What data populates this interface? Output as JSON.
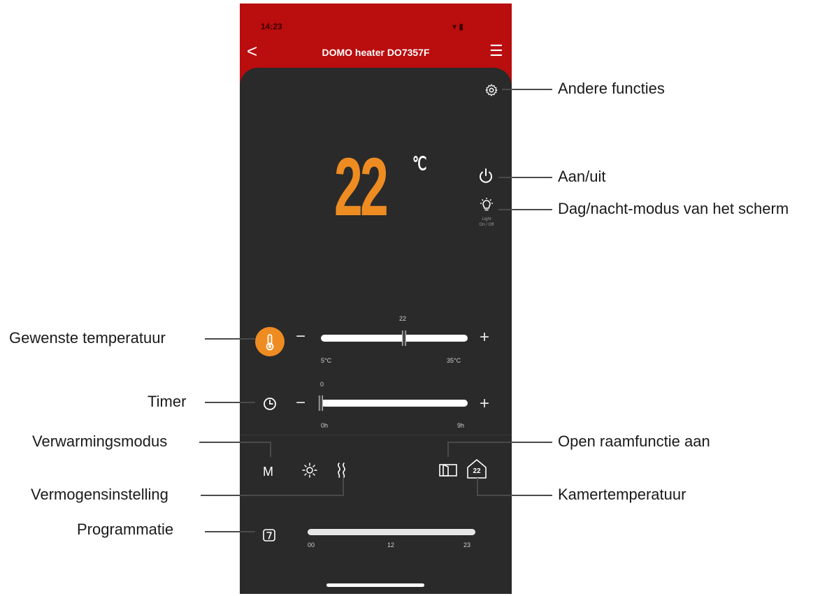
{
  "status": {
    "time": "14:23",
    "icons": "▾ ▮"
  },
  "header": {
    "back": "<",
    "title": "DOMO heater DO7357F",
    "menu": "☰"
  },
  "display": {
    "temperature": "22",
    "unit": "℃",
    "light_caption_1": "Light",
    "light_caption_2": "On / Off"
  },
  "desired_temp": {
    "minus": "−",
    "plus": "+",
    "value_label": "22",
    "min_label": "5°C",
    "max_label": "35°C",
    "value": 22,
    "min": 5,
    "max": 35
  },
  "timer": {
    "minus": "−",
    "plus": "+",
    "value_label": "0",
    "min_label": "0h",
    "max_label": "9h",
    "value": 0,
    "min": 0,
    "max": 9
  },
  "mode": {
    "heating_mode_label": "M",
    "room_temp_badge": "22"
  },
  "schedule": {
    "start": "00",
    "mid": "12",
    "end": "23"
  },
  "callouts": {
    "other_functions": "Andere functies",
    "power": "Aan/uit",
    "day_night": "Dag/nacht-modus van het scherm",
    "desired_temperature": "Gewenste temperatuur",
    "timer": "Timer",
    "heating_mode": "Verwarmingsmodus",
    "open_window": "Open raamfunctie aan",
    "power_setting": "Vermogensinstelling",
    "room_temperature": "Kamertemperatuur",
    "programming": "Programmatie"
  },
  "colors": {
    "header_red": "#b90d0e",
    "accent_orange": "#ee8c22",
    "panel_dark": "#2a2a2a"
  }
}
